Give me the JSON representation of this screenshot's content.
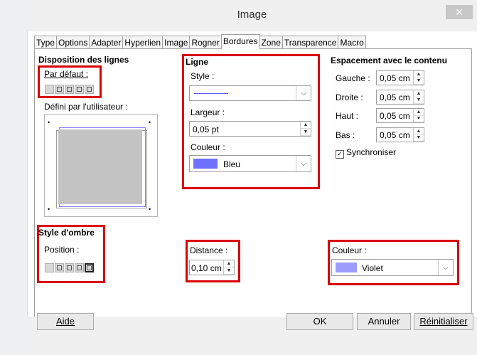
{
  "dialog": {
    "title": "Image",
    "close_label": "✕"
  },
  "tabs": [
    "Type",
    "Options",
    "Adapter",
    "Hyperlien",
    "Image",
    "Rogner",
    "Bordures",
    "Zone",
    "Transparence",
    "Macro"
  ],
  "line_arrangement": {
    "heading": "Disposition des lignes",
    "default_label": "Par défaut :",
    "user_defined_label": "Défini par l'utilisateur :"
  },
  "line": {
    "heading": "Ligne",
    "style_label": "Style :",
    "width_label": "Largeur :",
    "width_value": "0,05 pt",
    "color_label": "Couleur :",
    "color_value": "Bleu",
    "color_swatch": "#7070ff"
  },
  "padding": {
    "heading": "Espacement avec le contenu",
    "left_label": "Gauche :",
    "left_value": "0,05 cm",
    "right_label": "Droite :",
    "right_value": "0,05 cm",
    "top_label": "Haut :",
    "top_value": "0,05 cm",
    "bottom_label": "Bas :",
    "bottom_value": "0,05 cm",
    "sync_label": "Synchroniser",
    "sync_checked": true
  },
  "shadow": {
    "heading": "Style d'ombre",
    "position_label": "Position :",
    "distance_label": "Distance :",
    "distance_value": "0,10 cm",
    "color_label": "Couleur :",
    "color_value": "Violet",
    "color_swatch": "#9c9cff"
  },
  "buttons": {
    "help": "Aide",
    "ok": "OK",
    "cancel": "Annuler",
    "reset": "Réinitialiser"
  },
  "colors": {
    "highlight_red": "#d90000"
  }
}
